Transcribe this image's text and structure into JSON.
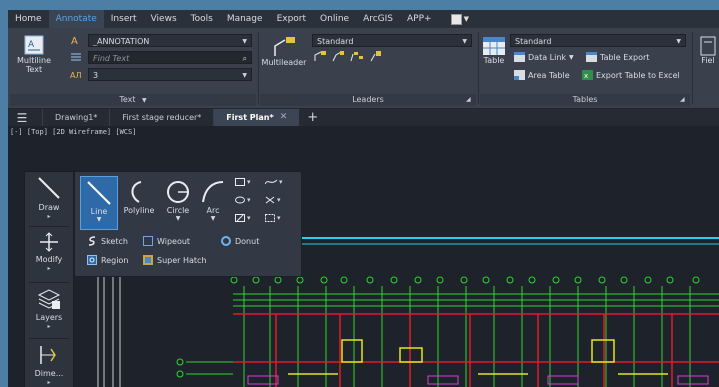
{
  "menu": {
    "items": [
      "Home",
      "Annotate",
      "Insert",
      "Views",
      "Tools",
      "Manage",
      "Export",
      "Online",
      "ArcGIS",
      "APP+"
    ],
    "active": "Annotate"
  },
  "ribbon": {
    "text_panel": {
      "title": "Text",
      "multiline_label_1": "Multiline",
      "multiline_label_2": "Text",
      "style_value": "_ANNOTATION",
      "find_placeholder": "Find Text",
      "height_value": "3"
    },
    "leaders_panel": {
      "title": "Leaders",
      "multileader_label": "Multileader",
      "style_value": "Standard"
    },
    "tables_panel": {
      "title": "Tables",
      "table_label": "Table",
      "style_value": "Standard",
      "data_link": "Data Link",
      "table_export": "Table Export",
      "area_table": "Area Table",
      "export_table_excel": "Export Table to Excel"
    },
    "fields_panel": {
      "label": "Fiel"
    }
  },
  "tabs": {
    "items": [
      {
        "label": "Drawing1*",
        "active": false
      },
      {
        "label": "First stage reducer*",
        "active": false
      },
      {
        "label": "First Plan*",
        "active": true
      }
    ]
  },
  "viewport": {
    "label": "[-] [Top] [2D Wireframe] [WCS]"
  },
  "palette": {
    "items": [
      "Draw",
      "Modify",
      "Layers",
      "Dime..."
    ]
  },
  "flyout": {
    "line": "Line",
    "polyline": "Polyline",
    "circle": "Circle",
    "arc": "Arc",
    "sketch": "Sketch",
    "wipeout": "Wipeout",
    "donut": "Donut",
    "region": "Region",
    "super_hatch": "Super Hatch"
  },
  "colors": {
    "accent": "#55a6e8",
    "selected": "#2f6aa8",
    "cad_green": "#2ed62e",
    "cad_cyan": "#21d4e6",
    "cad_red": "#d8202a",
    "cad_yellow": "#e4e41e",
    "cad_magenta": "#d43ed4"
  }
}
